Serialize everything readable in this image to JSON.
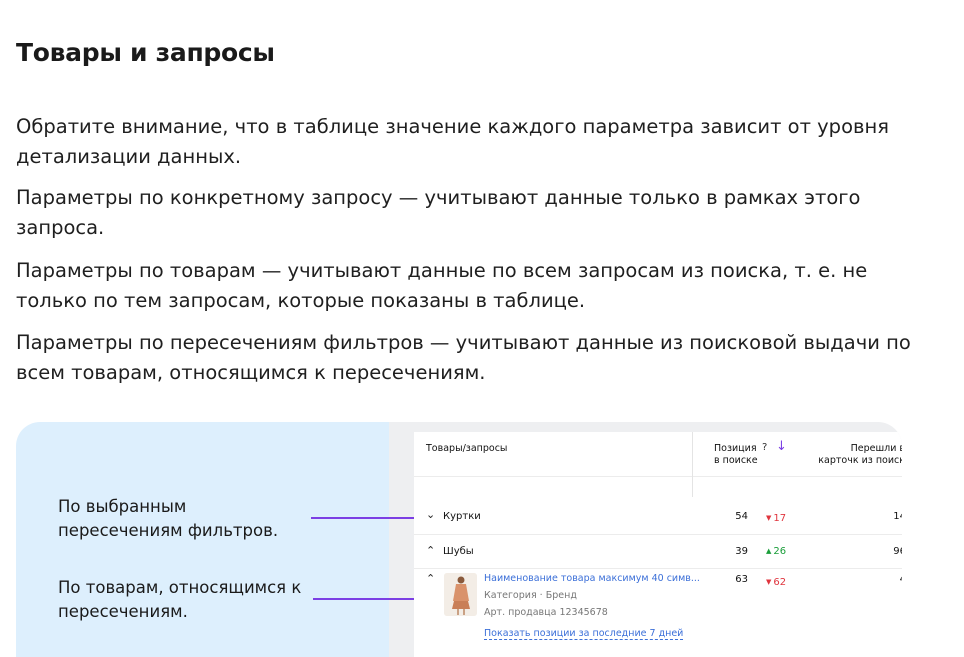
{
  "title": "Товары и запросы",
  "paragraphs": [
    "Обратите внимание, что в таблице значение каждого параметра зависит от уровня детализации данных.",
    "Параметры по конкретному запросу — учитывают данные только в рамках этого запроса.",
    "Параметры по товарам — учитывают данные по всем запросам из поиска, т. е. не только по тем запросам, которые показаны в таблице.",
    "Параметры по пересечениям фильтров — учитывают данные из поисковой выдачи по всем товарам, относящимся к пересечениям."
  ],
  "illustration": {
    "label_filters": "По выбранным пересечениям фильтров.",
    "label_products": "По товарам, относящимся к пересечениям.",
    "colors": {
      "panel_bg": "#ddeffd",
      "connector": "#7b3fe4",
      "table_bg": "#eeeff1"
    },
    "table": {
      "col_name": "Товары/запросы",
      "col_position": "Позиция в поиске",
      "col_help": "?",
      "col_transitions": "Перешли в карточк из поиск",
      "rows": [
        {
          "name": "Куртки",
          "position": "54",
          "delta": "17",
          "trend": "down",
          "transitions": "14",
          "chevron": "⌄"
        },
        {
          "name": "Шубы",
          "position": "39",
          "delta": "26",
          "trend": "up",
          "transitions": "96",
          "chevron": "⌃"
        }
      ],
      "product": {
        "position": "63",
        "delta": "62",
        "trend": "down",
        "transitions": "4",
        "name": "Наименование товара максимум 40 симв...",
        "category": "Категория · Бренд",
        "article": "Арт. продавца 12345678",
        "link": "Показать позиции за последние 7 дней",
        "chevron": "⌃"
      }
    }
  }
}
